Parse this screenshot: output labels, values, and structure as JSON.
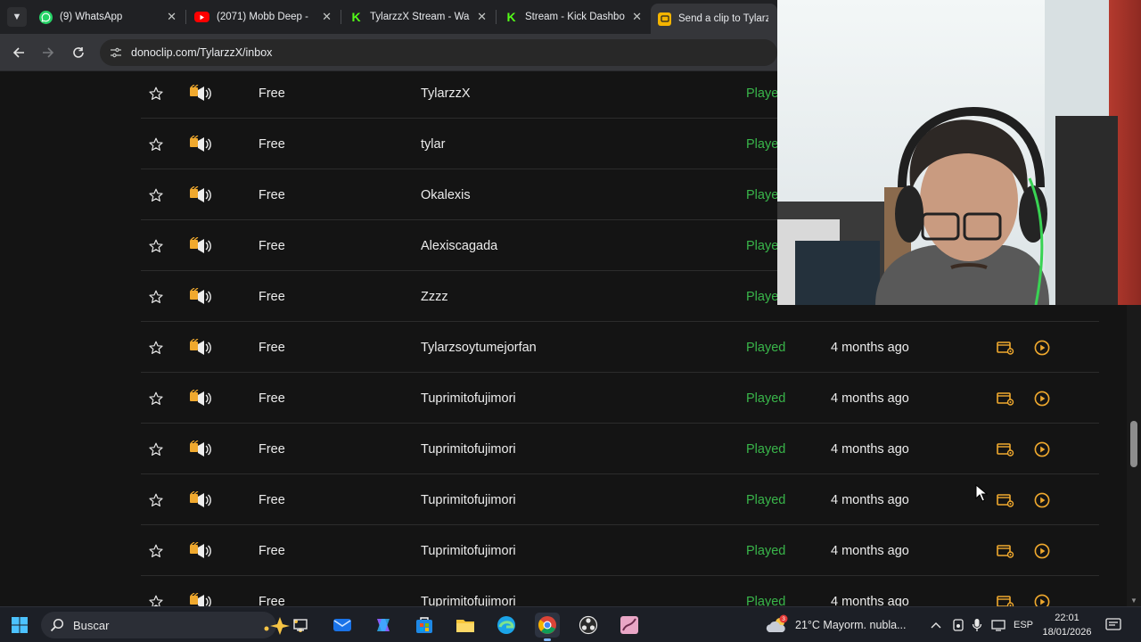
{
  "browser": {
    "tabs": [
      {
        "title": "(9) WhatsApp",
        "icon": "whatsapp-icon",
        "color": "#25D366"
      },
      {
        "title": "(2071) Mobb Deep - ",
        "icon": "youtube-icon",
        "color": "#FF0000"
      },
      {
        "title": "TylarzzX Stream - Wa",
        "icon": "kick-icon",
        "color": "#53FC18"
      },
      {
        "title": "Stream - Kick Dashbo",
        "icon": "kick-icon",
        "color": "#53FC18"
      },
      {
        "title": "Send a clip to Tylarzz",
        "icon": "donoclip-icon",
        "color": "#F4B400"
      }
    ],
    "url": "donoclip.com/TylarzzX/inbox"
  },
  "inbox": {
    "accent_color": "#F0A92E",
    "status_color": "#39B54A",
    "rows": [
      {
        "tier": "Free",
        "user": "TylarzzX",
        "status": "Played",
        "time": ""
      },
      {
        "tier": "Free",
        "user": "tylar",
        "status": "Played",
        "time": ""
      },
      {
        "tier": "Free",
        "user": "Okalexis",
        "status": "Played",
        "time": ""
      },
      {
        "tier": "Free",
        "user": "Alexiscagada",
        "status": "Played",
        "time": ""
      },
      {
        "tier": "Free",
        "user": "Zzzz",
        "status": "Played",
        "time": ""
      },
      {
        "tier": "Free",
        "user": "Tylarzsoytumejorfan",
        "status": "Played",
        "time": "4 months ago"
      },
      {
        "tier": "Free",
        "user": "Tuprimitofujimori",
        "status": "Played",
        "time": "4 months ago"
      },
      {
        "tier": "Free",
        "user": "Tuprimitofujimori",
        "status": "Played",
        "time": "4 months ago"
      },
      {
        "tier": "Free",
        "user": "Tuprimitofujimori",
        "status": "Played",
        "time": "4 months ago"
      },
      {
        "tier": "Free",
        "user": "Tuprimitofujimori",
        "status": "Played",
        "time": "4 months ago"
      },
      {
        "tier": "Free",
        "user": "Tuprimitofujimori",
        "status": "Played",
        "time": "4 months ago"
      }
    ]
  },
  "taskbar": {
    "search_placeholder": "Buscar",
    "weather": "21°C  Mayorm. nubla...",
    "language": "ESP",
    "time": "22:01",
    "date": "18/01/2026",
    "notification_count": "3"
  }
}
